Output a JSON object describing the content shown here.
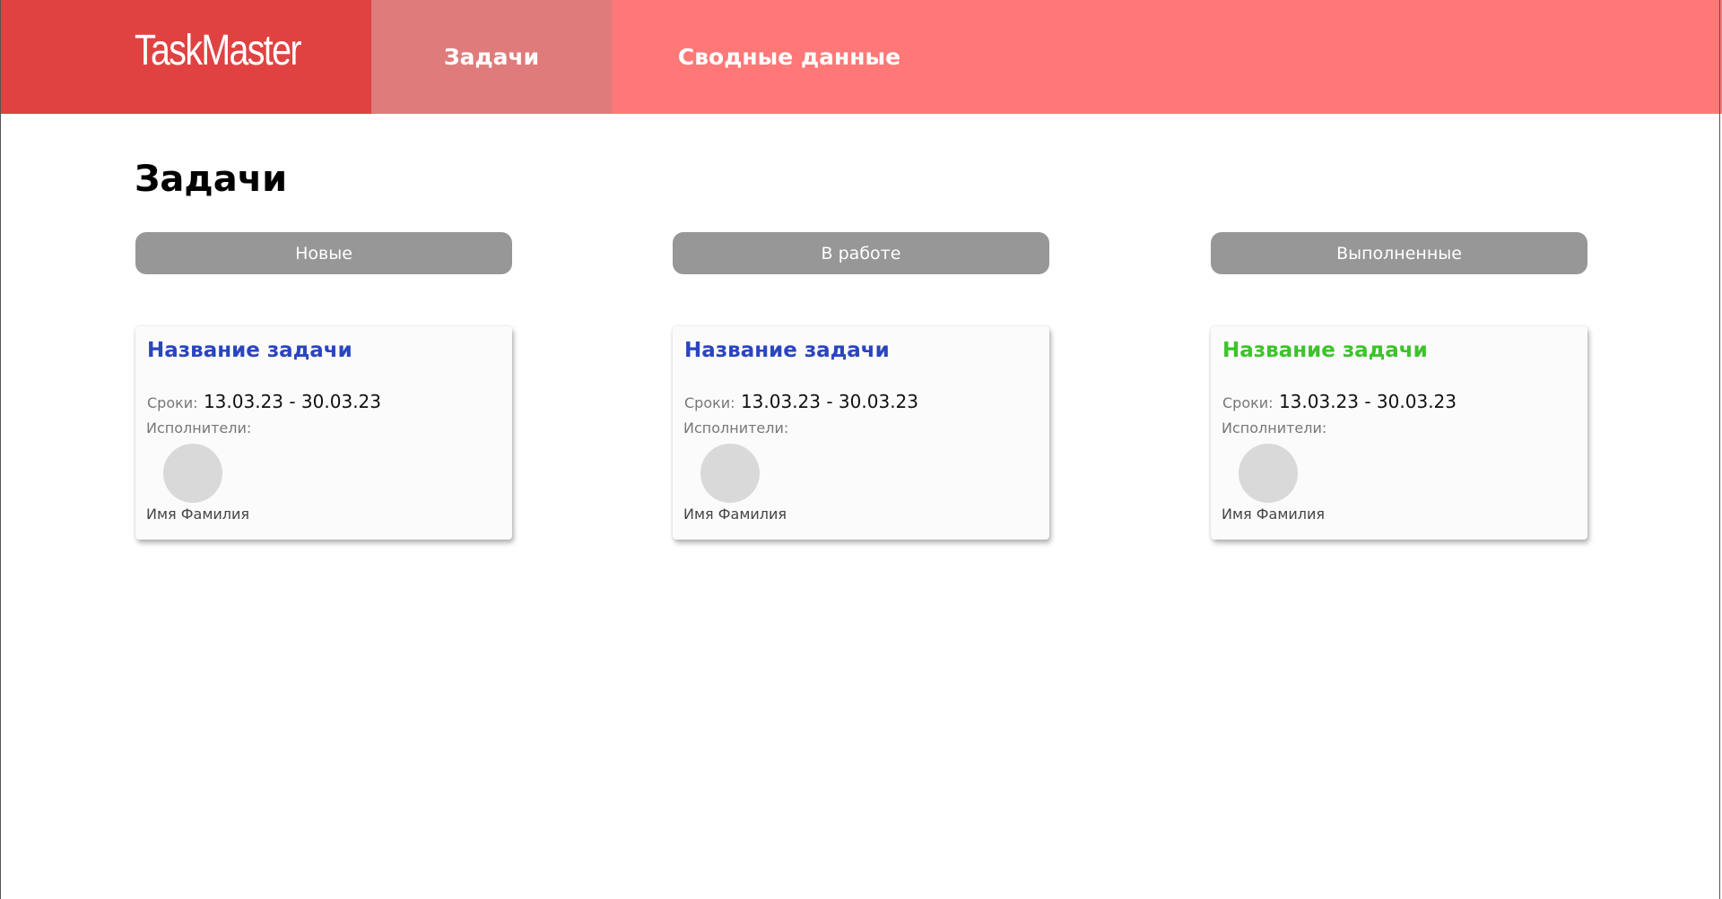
{
  "header": {
    "logo": "TaskMaster",
    "tabs": [
      {
        "label": "Задачи",
        "active": true
      },
      {
        "label": "Сводные данные",
        "active": false
      }
    ],
    "colors": {
      "bar": "#ff7878",
      "logo_block": "#e04242",
      "active_tab": "#df7b7b"
    }
  },
  "page": {
    "title": "Задачи"
  },
  "columns": [
    {
      "status_label": "Новые",
      "card": {
        "title": "Название задачи",
        "title_color": "#2a45c0",
        "dates_label": "Сроки:",
        "dates": "13.03.23 - 30.03.23",
        "assignees_label": "Исполнители:",
        "assignee_name": "Имя Фамилия"
      }
    },
    {
      "status_label": "В работе",
      "card": {
        "title": "Название задачи",
        "title_color": "#2a45c0",
        "dates_label": "Сроки:",
        "dates": "13.03.23 - 30.03.23",
        "assignees_label": "Исполнители:",
        "assignee_name": "Имя Фамилия"
      }
    },
    {
      "status_label": "Выполненные",
      "card": {
        "title": "Название задачи",
        "title_color": "#3cc42a",
        "dates_label": "Сроки:",
        "dates": "13.03.23 - 30.03.23",
        "assignees_label": "Исполнители:",
        "assignee_name": "Имя Фамилия"
      }
    }
  ]
}
